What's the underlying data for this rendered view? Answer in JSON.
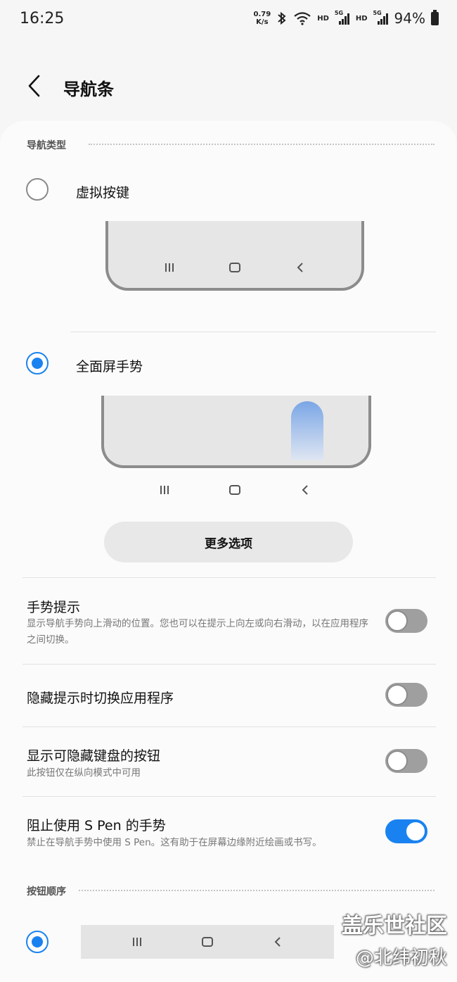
{
  "status": {
    "time": "16:25",
    "speed_value": "0.79",
    "speed_unit": "K/s",
    "hd1": "HD",
    "net1": "5G",
    "hd2": "HD",
    "net2": "5G",
    "battery": "94%"
  },
  "header": {
    "title": "导航条"
  },
  "nav_type": {
    "section_label": "导航类型",
    "options": [
      {
        "label": "虚拟按键",
        "selected": false
      },
      {
        "label": "全面屏手势",
        "selected": true
      }
    ],
    "more_button": "更多选项"
  },
  "settings": [
    {
      "title": "手势提示",
      "desc": "显示导航手势向上滑动的位置。您也可以在提示上向左或向右滑动，以在应用程序之间切换。",
      "on": false
    },
    {
      "title": "隐藏提示时切换应用程序",
      "desc": "",
      "on": false
    },
    {
      "title": "显示可隐藏键盘的按钮",
      "desc": "此按钮仅在纵向模式中可用",
      "on": false
    },
    {
      "title": "阻止使用 S Pen 的手势",
      "desc": "禁止在导航手势中使用 S Pen。这有助于在屏幕边缘附近绘画或书写。",
      "on": true
    }
  ],
  "button_order": {
    "section_label": "按钮顺序"
  },
  "icons": {
    "back": "back-arrow-icon",
    "recents": "recents-icon",
    "home": "home-icon",
    "nav_back": "nav-back-icon"
  },
  "colors": {
    "accent": "#1a82f0",
    "toggle_off": "#9f9f9f"
  },
  "watermark": {
    "line1": "盖乐世社区",
    "line2": "@北纬初秋"
  }
}
